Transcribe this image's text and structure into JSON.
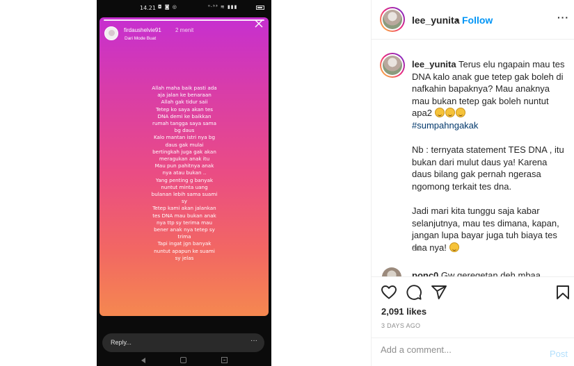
{
  "phone": {
    "status_time": "14.21",
    "status_icons": "◘ ◙ ◎",
    "status_network": "⁰·⁵³ ≋ ▮▮▮"
  },
  "story": {
    "username": "firdaushelvie91",
    "time_ago": "2 menit",
    "subtitle": "Dari Mode Buat",
    "text_lines": [
      "Allah maha baik pasti ada",
      "aja jalan ke benaraan",
      "Allah gak tidur saii",
      "Tetep ko saya akan tes",
      "DNA demi ke baikkan",
      "rumah tangga saya sama",
      "bg daus",
      "Kalo mantan istri nya bg",
      "daus gak mulai",
      "bertingkah juga gak akan",
      "meragukan anak itu",
      "Mau pun pahitnya anak",
      "nya atau bukan ..",
      "Yang penting g banyak",
      "nuntut minta uang",
      "bulanan lebih sama suami",
      "sy",
      "Tetep kami akan jalankan",
      "tes DNA mau bukan anak",
      "nya ttp sy terima mau",
      "bener anak nya tetep sy",
      "trima",
      "Tapi ingat jgn banyak",
      "nuntut apapun ke suami",
      "sy jelas"
    ],
    "reply_placeholder": "Reply...",
    "reply_more": "···"
  },
  "header": {
    "username": "lee_yunita",
    "separator": "•",
    "follow_label": "Follow",
    "more_label": "···"
  },
  "caption": {
    "username": "lee_yunita",
    "para1": "Terus elu ngapain mau tes DNA kalo anak gue tetep gak boleh di nafkahin bapaknya? Mau anaknya mau bukan tetep gak boleh nuntut apa2",
    "hashtag": "#sumpahngakak",
    "para2": "Nb : ternyata statement TES DNA , itu bukan dari mulut daus ya! Karena daus bilang gak pernah ngerasa ngomong terkait tes dna.",
    "para3": "Jadi mari kita tunggu saja kabar selanjutnya, mau tes dimana, kapan, jangan lupa bayar juga tuh biaya tes dna nya!",
    "age": "3d"
  },
  "comment2": {
    "username": "ponc0",
    "text": "Gw geregetan deh mbaa..."
  },
  "actions": {
    "likes": "2,091 likes",
    "date": "3 DAYS AGO"
  },
  "add_comment": {
    "placeholder": "Add a comment...",
    "post_label": "Post"
  },
  "colors": {
    "follow": "#0095f6",
    "hashtag": "#00376b",
    "post_disabled": "#b2dffc",
    "story_gradient": [
      "#c62fd0",
      "#ea4c84",
      "#f58850"
    ]
  }
}
